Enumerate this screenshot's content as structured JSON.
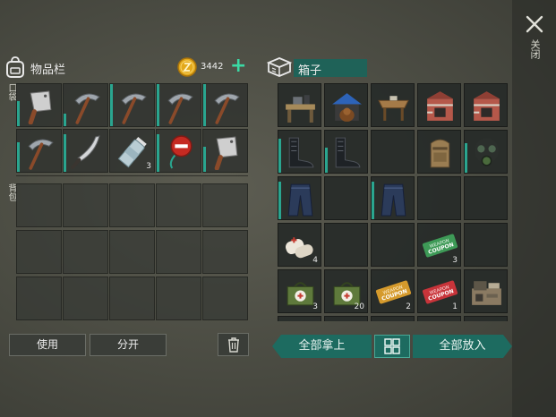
{
  "close": {
    "label": "关闭"
  },
  "inventory": {
    "title": "物品栏",
    "coins": "3442",
    "add_label": "+",
    "pocket_label": "口袋",
    "backpack_label": "背包",
    "pocket_slots": [
      {
        "item": "cleaver",
        "durability": 0.6
      },
      {
        "item": "pickaxe",
        "durability": 0.3
      },
      {
        "item": "pickaxe",
        "durability": 1.0
      },
      {
        "item": "pickaxe",
        "durability": 1.0
      },
      {
        "item": "pickaxe",
        "durability": 1.0
      },
      {
        "item": "pickaxe",
        "durability": 0.7
      },
      {
        "item": "machete",
        "durability": 0.9
      },
      {
        "item": "water-bottle",
        "qty": "3"
      },
      {
        "item": "stop-sign",
        "durability": 0.9
      },
      {
        "item": "cleaver",
        "durability": 0.6
      }
    ],
    "backpack_slots": 15
  },
  "box": {
    "title": "箱子",
    "slots": [
      {
        "item": "workbench"
      },
      {
        "item": "dog-house"
      },
      {
        "item": "wood-table"
      },
      {
        "item": "furnace"
      },
      {
        "item": "furnace"
      },
      {
        "item": "boots",
        "durability": 0.8
      },
      {
        "item": "boots",
        "durability": 0.6
      },
      {
        "item": ""
      },
      {
        "item": "backpack"
      },
      {
        "item": "gas-mask",
        "durability": 0.7
      },
      {
        "item": "jeans",
        "durability": 0.9
      },
      {
        "item": ""
      },
      {
        "item": "jeans",
        "durability": 0.9
      },
      {
        "item": ""
      },
      {
        "item": ""
      },
      {
        "item": "bandages",
        "qty": "4"
      },
      {
        "item": ""
      },
      {
        "item": ""
      },
      {
        "item": "green-coupon",
        "qty": "3"
      },
      {
        "item": ""
      },
      {
        "item": "medkit-bag",
        "qty": "3"
      },
      {
        "item": "medkit-bag",
        "qty": "20"
      },
      {
        "item": "gold-coupon",
        "qty": "2"
      },
      {
        "item": "red-coupon",
        "qty": "1"
      },
      {
        "item": "workshop-station"
      }
    ]
  },
  "coupon_text": {
    "line1": "WEAPON",
    "line2": "COUPON"
  },
  "buttons": {
    "use": "使用",
    "split": "分开",
    "take_all": "全部拿上",
    "put_all": "全部放入"
  },
  "colors": {
    "accent": "#1d6b60",
    "plus": "#3bd9a4",
    "durability": "#2aa58f"
  }
}
